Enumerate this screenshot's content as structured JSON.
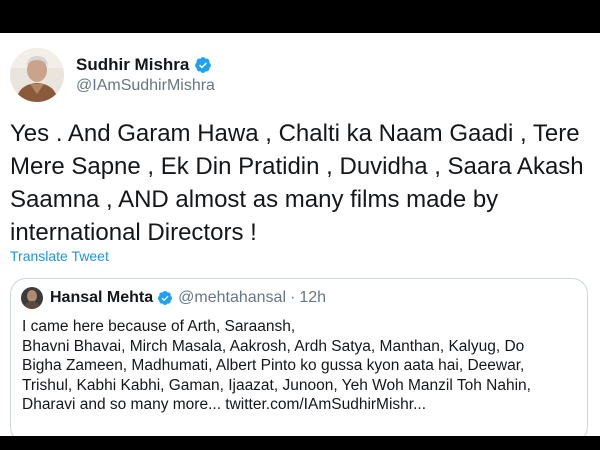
{
  "colors": {
    "link": "#1b95e0",
    "verified": "#1da1f2",
    "secondary_text": "#657786",
    "primary_text": "#14171a",
    "border": "#ccd6dd",
    "frame": "#000000"
  },
  "tweet": {
    "author": {
      "name": "Sudhir Mishra",
      "handle": "@IAmSudhirMishra",
      "verified_icon": "verified-badge-icon"
    },
    "text_lines": [
      "Yes . And Garam Hawa , Chalti ka Naam Gaadi , Tere",
      "Mere Sapne , Ek Din Pratidin , Duvidha , Saara Akash",
      "Saamna , AND almost as many films made by",
      "international Directors !"
    ],
    "translate_label": "Translate Tweet"
  },
  "quoted_tweet": {
    "author": {
      "name": "Hansal Mehta",
      "handle": "@mehtahansal",
      "verified_icon": "verified-badge-icon"
    },
    "separator": "·",
    "time": "12h",
    "text_lines": [
      "I came here because of Arth, Saraansh,",
      "Bhavni Bhavai, Mirch Masala, Aakrosh, Ardh Satya, Manthan, Kalyug, Do",
      "Bigha Zameen, Madhumati, Albert Pinto ko gussa kyon aata hai, Deewar,",
      "Trishul, Kabhi Kabhi, Gaman, Ijaazat, Junoon, Yeh Woh Manzil Toh Nahin,",
      "Dharavi and so many more... twitter.com/IAmSudhirMishr..."
    ]
  }
}
